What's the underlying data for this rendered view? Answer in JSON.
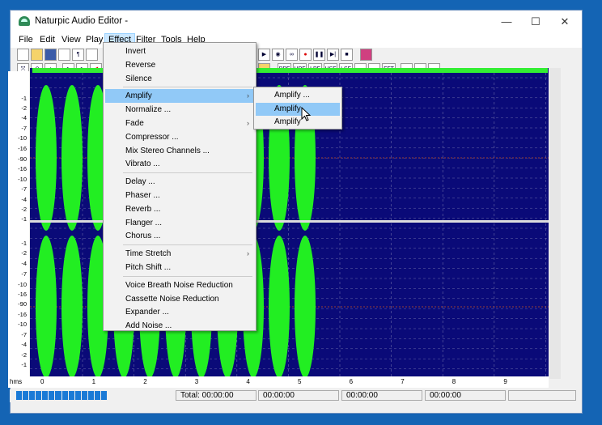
{
  "window": {
    "title": "Naturpic Audio Editor -",
    "min": "—",
    "max": "☐",
    "close": "✕"
  },
  "menubar": [
    "File",
    "Edit",
    "View",
    "Play",
    "Effect",
    "Filter",
    "Tools",
    "Help"
  ],
  "toolbar2_labels": [
    "BPF",
    "HPF",
    "LPF",
    "HSF",
    "LSF",
    "FFT"
  ],
  "ruler_labels": [
    "-1",
    "-2",
    "-4",
    "-7",
    "-10",
    "-16",
    "-90",
    "-16",
    "-10",
    "-7",
    "-4",
    "-2",
    "-1",
    "-1",
    "-2",
    "-4",
    "-7",
    "-10",
    "-16",
    "-90",
    "-16",
    "-10",
    "-7",
    "-4",
    "-2",
    "-1"
  ],
  "timeline": {
    "unit": "hms",
    "ticks": [
      "0",
      "1",
      "2",
      "3",
      "4",
      "5",
      "6",
      "7",
      "8",
      "9"
    ]
  },
  "status": {
    "total": "Total: 00:00:00",
    "f1": "00:00:00",
    "f2": "00:00:00",
    "f3": "00:00:00"
  },
  "effect_menu": {
    "groups": [
      [
        "Invert",
        "Reverse",
        "Silence"
      ],
      [
        "Amplify",
        "Normalize ...",
        "Fade",
        "Compressor ...",
        "Mix Stereo Channels ...",
        "Vibrato ..."
      ],
      [
        "Delay ...",
        "Phaser ...",
        "Reverb ...",
        "Flanger ...",
        "Chorus ..."
      ],
      [
        "Time Stretch",
        "Pitch Shift ..."
      ],
      [
        "Voice Breath Noise Reduction",
        "Cassette Noise Reduction",
        "Expander ...",
        "Add Noise ..."
      ]
    ],
    "submenu_items": [
      "Amplify",
      "Fade",
      "Time Stretch"
    ],
    "highlighted": "Amplify"
  },
  "amplify_submenu": {
    "items": [
      "Amplify ...",
      "Amplify",
      "Amplify"
    ],
    "highlighted_index": 1
  },
  "colors": {
    "wave": "#22ee22",
    "background": "#0a0a78",
    "accent": "#1a7ad6"
  }
}
